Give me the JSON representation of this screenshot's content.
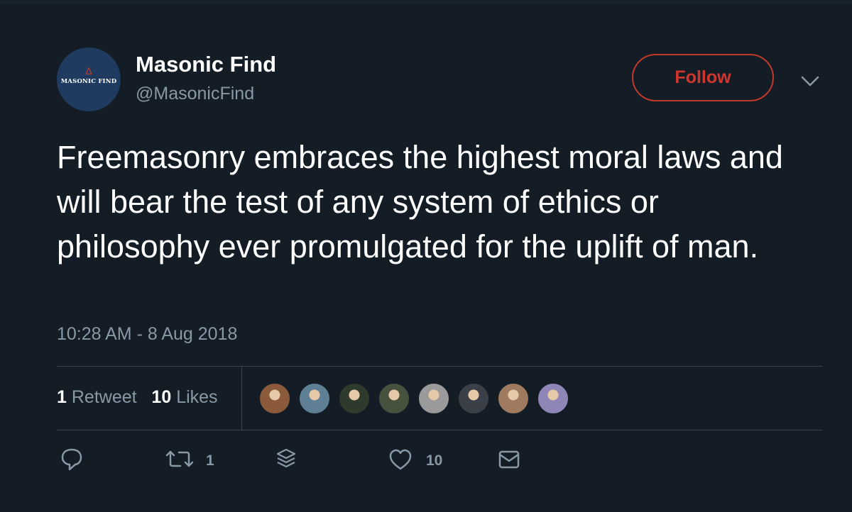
{
  "author": {
    "name": "Masonic Find",
    "handle": "@MasonicFind",
    "avatar_text": "MASONIC FIND"
  },
  "follow_label": "Follow",
  "tweet": {
    "text": "Freemasonry embraces the highest moral laws and will bear the test of any system of ethics or philosophy ever promulgated for the uplift of man.",
    "timestamp": "10:28 AM - 8 Aug 2018"
  },
  "stats": {
    "retweets_count": "1",
    "retweets_label": "Retweet",
    "likes_count": "10",
    "likes_label": "Likes"
  },
  "likers": [
    {
      "name": "liker-1",
      "color": "#8a5a3a"
    },
    {
      "name": "liker-2",
      "color": "#5f7f95"
    },
    {
      "name": "liker-3",
      "color": "#2e3a2c"
    },
    {
      "name": "liker-4",
      "color": "#46513e"
    },
    {
      "name": "liker-5",
      "color": "#9a9a9a"
    },
    {
      "name": "liker-6",
      "color": "#3b3f48"
    },
    {
      "name": "liker-7",
      "color": "#a07a5e"
    },
    {
      "name": "liker-8",
      "color": "#8f86b8"
    }
  ],
  "actions": {
    "reply_icon": "reply-icon",
    "retweet_icon": "retweet-icon",
    "retweet_count": "1",
    "buffer_icon": "stack-icon",
    "like_icon": "heart-icon",
    "like_count": "10",
    "dm_icon": "mail-icon"
  },
  "colors": {
    "background": "#141d26",
    "follow_accent": "#c0392b",
    "muted_text": "#8899a6"
  }
}
